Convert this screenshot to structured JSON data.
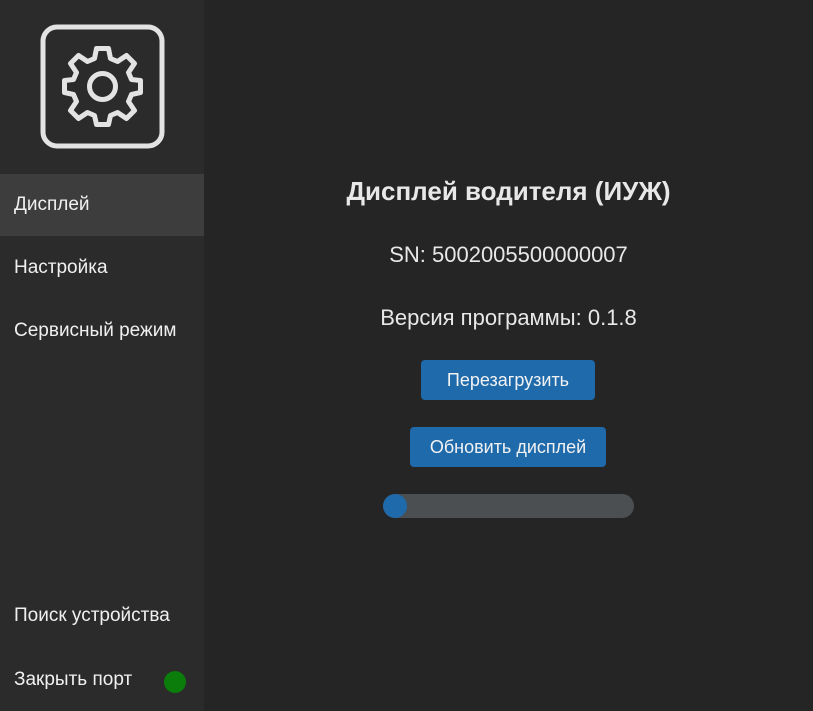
{
  "sidebar": {
    "logo_icon": "gear-icon",
    "items": [
      {
        "label": "Дисплей",
        "active": true
      },
      {
        "label": "Настройка",
        "active": false
      },
      {
        "label": "Сервисный режим",
        "active": false
      }
    ],
    "bottom_items": [
      {
        "label": "Поиск устройства"
      },
      {
        "label": "Закрыть порт"
      }
    ],
    "port_status_color": "#0a7d0a"
  },
  "main": {
    "title": "Дисплей водителя (ИУЖ)",
    "serial": "SN: 5002005500000007",
    "version": "Версия программы: 0.1.8",
    "reboot_label": "Перезагрузить",
    "update_label": "Обновить дисплей",
    "progress_percent": 5
  },
  "colors": {
    "accent": "#1f6aab",
    "sidebar_bg": "#2b2b2b",
    "main_bg": "#252525",
    "active_item_bg": "#3d3d3d"
  }
}
